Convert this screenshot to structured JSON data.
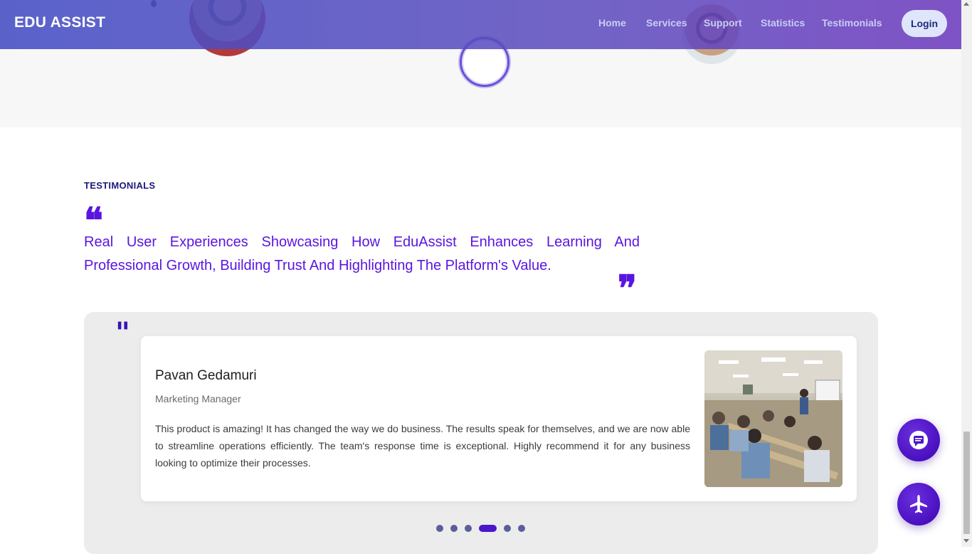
{
  "navbar": {
    "brand": "EDU ASSIST",
    "links": [
      "Home",
      "Services",
      "Support",
      "Statistics",
      "Testimonials"
    ],
    "login_label": "Login"
  },
  "testimonials": {
    "section_label": "TESTIMONIALS",
    "open_quote": "❝",
    "close_quote": "❞",
    "headline": "Real User Experiences Showcasing How EduAssist Enhances Learning And Professional Growth, Building Trust And Highlighting The Platform's Value.",
    "card_quote_mark": "\"",
    "card": {
      "name": "Pavan Gedamuri",
      "role": "Marketing Manager",
      "text": "This product is amazing! It has changed the way we do business. The results speak for themselves, and we are now able to streamline operations efficiently. The team's response time is exceptional. Highly recommend it for any business looking to optimize their processes.",
      "photo_icon": "classroom-photo"
    },
    "pagination": {
      "total": 6,
      "active_index": 3
    }
  },
  "floating_buttons": {
    "chat_icon": "chat-icon",
    "plane_icon": "airplane-icon"
  },
  "colors": {
    "accent": "#5a16e0",
    "nav_gradient_start": "#444ec4",
    "nav_gradient_end": "#6e3cbe"
  }
}
